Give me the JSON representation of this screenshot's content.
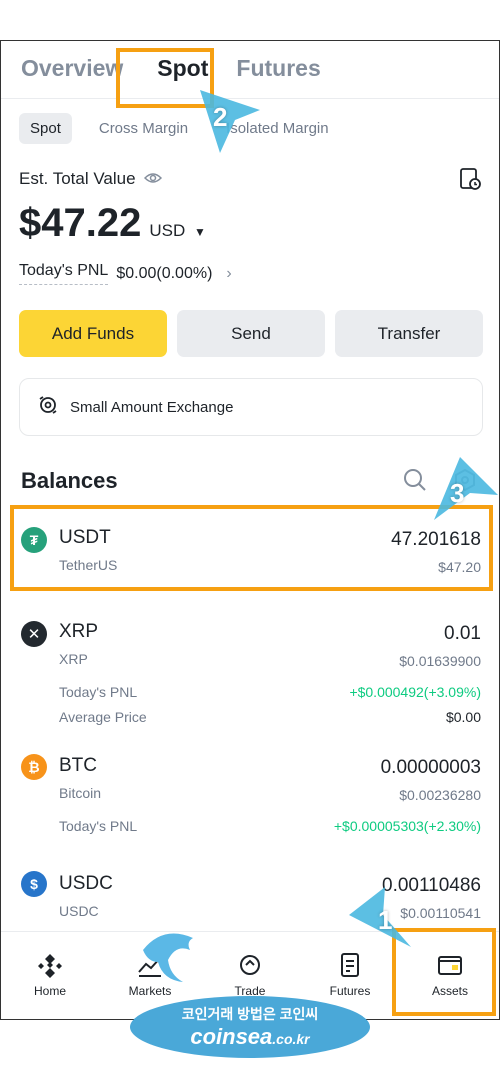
{
  "tabs": {
    "overview": "Overview",
    "spot": "Spot",
    "futures": "Futures"
  },
  "sub_tabs": {
    "spot": "Spot",
    "cross_margin": "Cross Margin",
    "isolated_margin": "Isolated Margin"
  },
  "summary": {
    "est_label": "Est. Total Value",
    "total_amount": "$47.22",
    "currency": "USD",
    "pnl_label": "Today's PNL",
    "pnl_value": "$0.00(0.00%)"
  },
  "actions": {
    "add_funds": "Add Funds",
    "send": "Send",
    "transfer": "Transfer"
  },
  "small_exchange": "Small Amount Exchange",
  "balances": {
    "title": "Balances",
    "assets": [
      {
        "symbol": "USDT",
        "name": "TetherUS",
        "amount": "47.201618",
        "fiat": "$47.20",
        "icon": "tether-icon",
        "color": "#26a17b"
      },
      {
        "symbol": "XRP",
        "name": "XRP",
        "amount": "0.01",
        "fiat": "$0.01639900",
        "icon": "xrp-icon",
        "color": "#23292f",
        "pnl_label": "Today's PNL",
        "pnl_value": "+$0.000492(+3.09%)",
        "avg_label": "Average Price",
        "avg_value": "$0.00"
      },
      {
        "symbol": "BTC",
        "name": "Bitcoin",
        "amount": "0.00000003",
        "fiat": "$0.00236280",
        "icon": "bitcoin-icon",
        "color": "#f7931a",
        "pnl_label": "Today's PNL",
        "pnl_value": "+$0.00005303(+2.30%)"
      },
      {
        "symbol": "USDC",
        "name": "USDC",
        "amount": "0.00110486",
        "fiat": "$0.00110541",
        "icon": "usdc-icon",
        "color": "#2775ca"
      }
    ]
  },
  "nav": {
    "home": "Home",
    "markets": "Markets",
    "trade": "Trade",
    "futures": "Futures",
    "assets": "Assets"
  },
  "annotations": {
    "num1": "1",
    "num2": "2",
    "num3": "3",
    "highlight_color": "#f6a012",
    "callout_color": "#4ab8e0"
  },
  "watermark": {
    "line1": "코인거래 방법은 코인씨",
    "line2": "coinsea",
    "line2_suffix": ".co.kr"
  },
  "colors": {
    "accent": "#fcd535",
    "positive": "#0ecb81",
    "muted": "#707a8a"
  }
}
